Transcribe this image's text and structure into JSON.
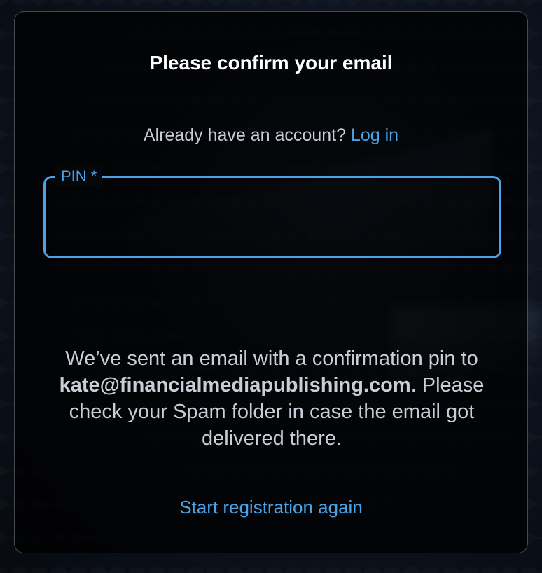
{
  "dialog": {
    "title": "Please confirm your email",
    "login_prompt": "Already have an account?",
    "login_link": "Log in",
    "pin_field": {
      "label": "PIN *",
      "value": "",
      "placeholder": ""
    },
    "message": {
      "before_email": "We’ve sent an email with a confirmation pin to",
      "email": "kate@financialmediapublishing.com",
      "after_email": ". Please check your Spam folder in case the email got delivered there."
    },
    "restart_link": "Start registration again"
  },
  "colors": {
    "accent": "#4aa3e6",
    "text_primary": "#ffffff",
    "text_secondary": "#c9ced6",
    "card_border": "#4a4d52"
  }
}
